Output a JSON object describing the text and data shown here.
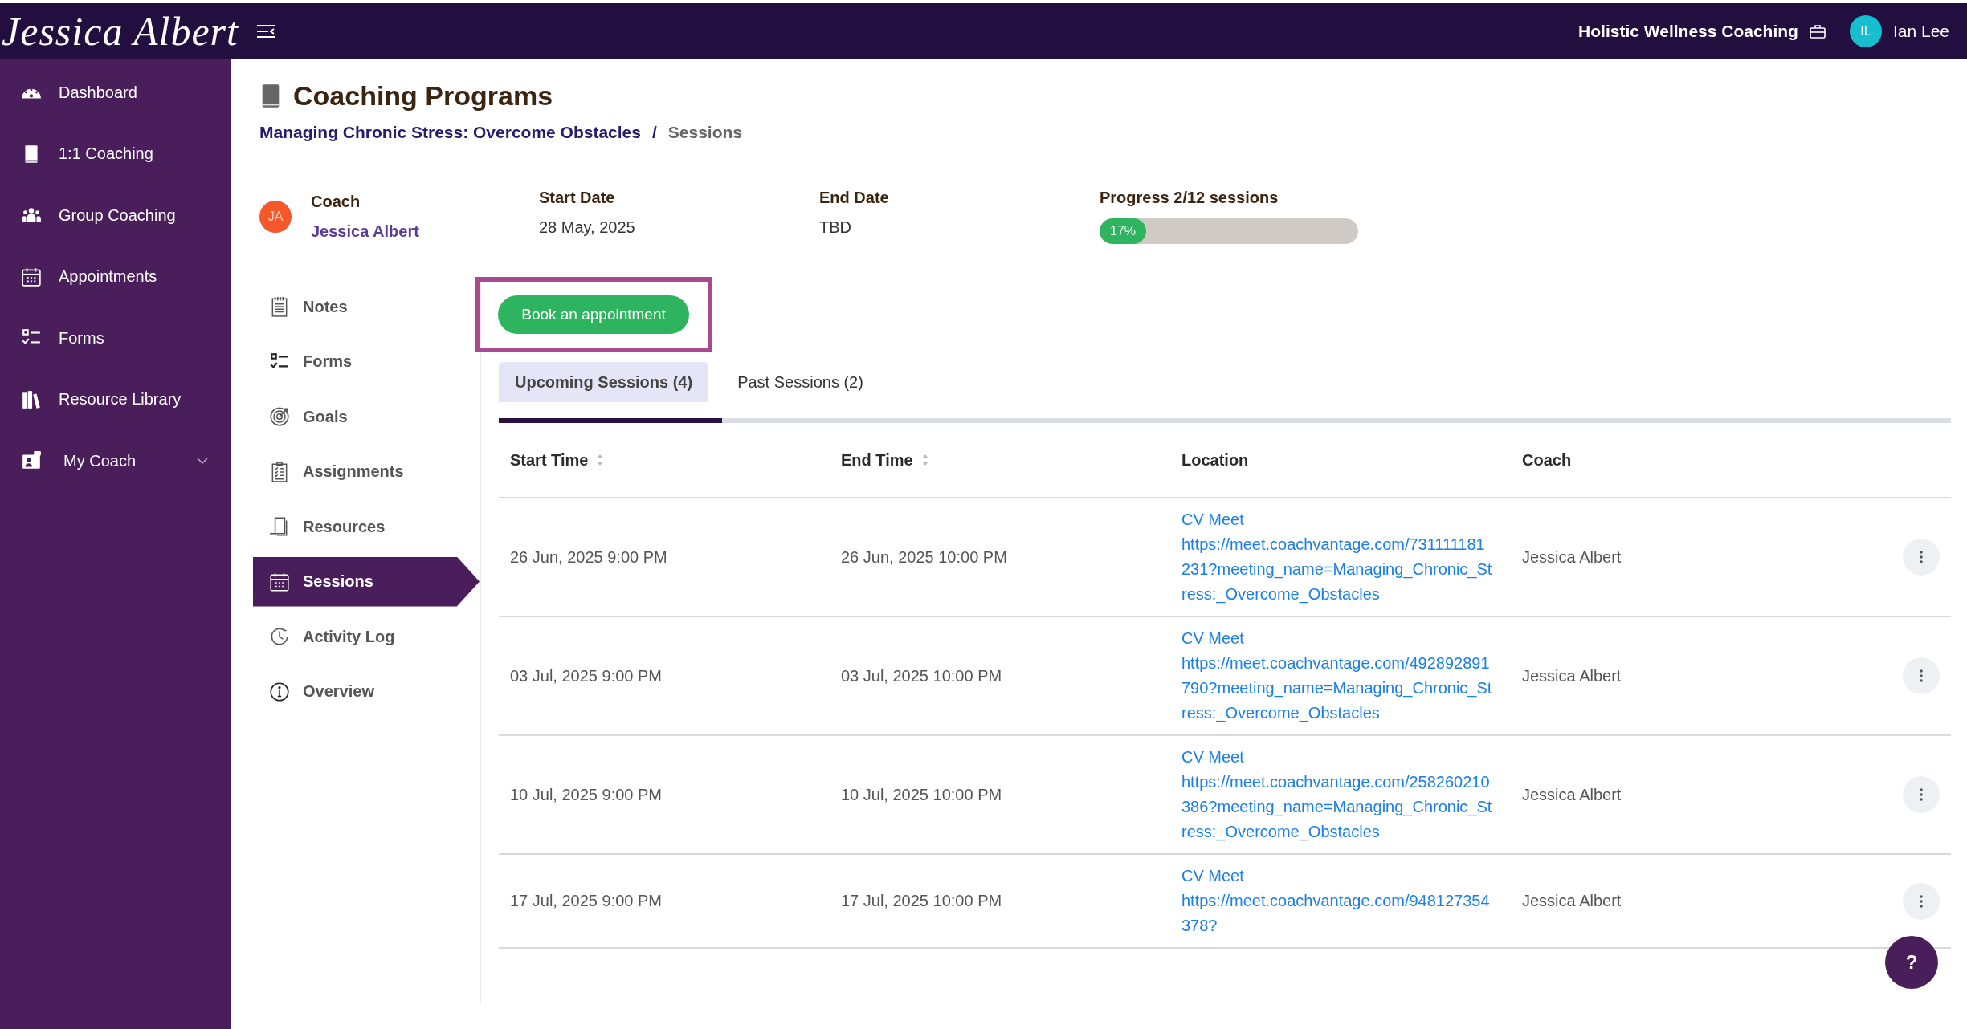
{
  "topbar": {
    "logo": "Jessica Albert",
    "organization": "Holistic Wellness Coaching",
    "user": {
      "initials": "IL",
      "name": "Ian Lee"
    }
  },
  "sidebar": {
    "items": [
      {
        "label": "Dashboard",
        "selected": false,
        "expandable": false
      },
      {
        "label": "1:1 Coaching",
        "selected": false,
        "expandable": false
      },
      {
        "label": "Group Coaching",
        "selected": false,
        "expandable": false
      },
      {
        "label": "Appointments",
        "selected": false,
        "expandable": false
      },
      {
        "label": "Forms",
        "selected": false,
        "expandable": false
      },
      {
        "label": "Resource Library",
        "selected": false,
        "expandable": false
      },
      {
        "label": "My Coach",
        "selected": false,
        "expandable": true
      }
    ]
  },
  "page": {
    "title": "Coaching Programs",
    "breadcrumb": [
      {
        "label": "Managing Chronic Stress: Overcome Obstacles",
        "kind": "link"
      },
      {
        "label": "/",
        "kind": "separator"
      },
      {
        "label": "Sessions",
        "kind": "current"
      }
    ]
  },
  "program": {
    "coach": {
      "label": "Coach",
      "initials": "JA",
      "name": "Jessica Albert"
    },
    "start": {
      "label": "Start Date",
      "value": "28 May, 2025"
    },
    "end": {
      "label": "End Date",
      "value": "TBD"
    },
    "progress": {
      "label": "Progress 2/12 sessions",
      "reading": "17%",
      "level": 0.17
    }
  },
  "subnav": {
    "items": [
      {
        "label": "Notes",
        "selected": false
      },
      {
        "label": "Forms",
        "selected": false
      },
      {
        "label": "Goals",
        "selected": false
      },
      {
        "label": "Assignments",
        "selected": false
      },
      {
        "label": "Resources",
        "selected": false
      },
      {
        "label": "Sessions",
        "selected": true
      },
      {
        "label": "Activity Log",
        "selected": false
      },
      {
        "label": "Overview",
        "selected": false
      }
    ]
  },
  "book_button": {
    "label": "Book an appointment",
    "highlighted": true
  },
  "tabs": [
    {
      "label": "Upcoming Sessions (4)",
      "selected": true
    },
    {
      "label": "Past Sessions (2)",
      "selected": false
    }
  ],
  "table": {
    "columns": [
      {
        "label": "Start Time",
        "sortable": true
      },
      {
        "label": "End Time",
        "sortable": true
      },
      {
        "label": "Location",
        "sortable": false
      },
      {
        "label": "Coach",
        "sortable": false
      }
    ],
    "rows": [
      {
        "start": "26 Jun, 2025 9:00 PM",
        "end": "26 Jun, 2025 10:00 PM",
        "location": "CV Meet",
        "url": "https://meet.coachvantage.com/731111181231?meeting_name=Managing_Chronic_Stress:_Overcome_Obstacles",
        "coach": "Jessica Albert"
      },
      {
        "start": "03 Jul, 2025 9:00 PM",
        "end": "03 Jul, 2025 10:00 PM",
        "location": "CV Meet",
        "url": "https://meet.coachvantage.com/492892891790?meeting_name=Managing_Chronic_Stress:_Overcome_Obstacles",
        "coach": "Jessica Albert"
      },
      {
        "start": "10 Jul, 2025 9:00 PM",
        "end": "10 Jul, 2025 10:00 PM",
        "location": "CV Meet",
        "url": "https://meet.coachvantage.com/258260210386?meeting_name=Managing_Chronic_Stress:_Overcome_Obstacles",
        "coach": "Jessica Albert"
      },
      {
        "start": "17 Jul, 2025 9:00 PM",
        "end": "17 Jul, 2025 10:00 PM",
        "location": "CV Meet",
        "url": "https://meet.coachvantage.com/948127354378?",
        "coach": "Jessica Albert"
      }
    ]
  },
  "help_button": {
    "label": "?"
  }
}
